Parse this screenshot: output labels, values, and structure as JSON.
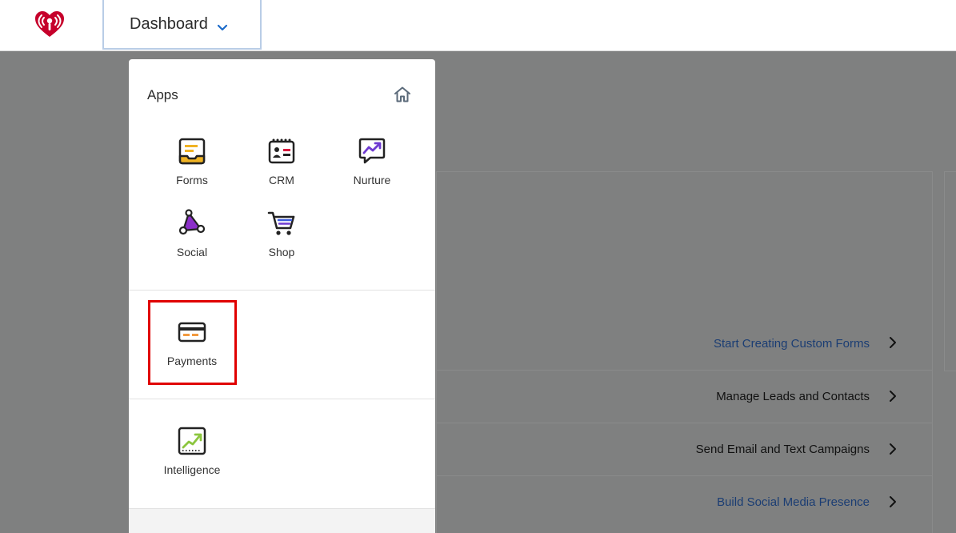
{
  "header": {
    "logo": "iheart-logo",
    "dashboard_label": "Dashboard"
  },
  "menu": {
    "title": "Apps",
    "home_icon": "home-icon",
    "apps": [
      {
        "label": "Forms",
        "icon": "forms-icon"
      },
      {
        "label": "CRM",
        "icon": "crm-icon"
      },
      {
        "label": "Nurture",
        "icon": "nurture-icon"
      },
      {
        "label": "Social",
        "icon": "social-icon"
      },
      {
        "label": "Shop",
        "icon": "shop-icon"
      }
    ],
    "payments": {
      "label": "Payments",
      "icon": "payments-icon"
    },
    "intelligence": {
      "label": "Intelligence",
      "icon": "intelligence-icon"
    }
  },
  "background_links": [
    {
      "label": "Start Creating Custom Forms"
    },
    {
      "label": "Manage Leads and Contacts"
    },
    {
      "label": "Send Email and Text Campaigns"
    },
    {
      "label": "Build Social Media Presence"
    }
  ],
  "colors": {
    "brand_red": "#c6002b",
    "accent_blue": "#1b6ac9",
    "highlight_red": "#e00000",
    "overlay": "#7f8080"
  }
}
